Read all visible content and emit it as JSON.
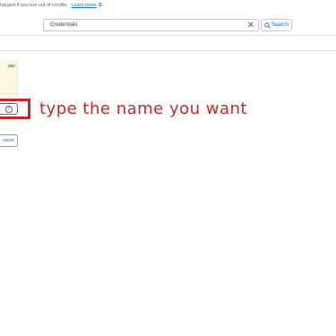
{
  "notice": {
    "text": "harged if you run out of credits.",
    "link_label": "Learn more",
    "link_icon": "open-in-new-icon"
  },
  "search": {
    "value": "Credentials",
    "clear_icon": "close-icon",
    "button_label": "Search",
    "button_icon": "search-icon"
  },
  "info_box": {
    "text": "ase"
  },
  "name_field": {
    "help_icon": "help-circle-icon"
  },
  "annotation": "type the name you want",
  "browse_button": {
    "label": "owse"
  },
  "colors": {
    "accent": "#1a73e8",
    "annotation": "#c62828",
    "info_bg": "#fef7e0"
  }
}
